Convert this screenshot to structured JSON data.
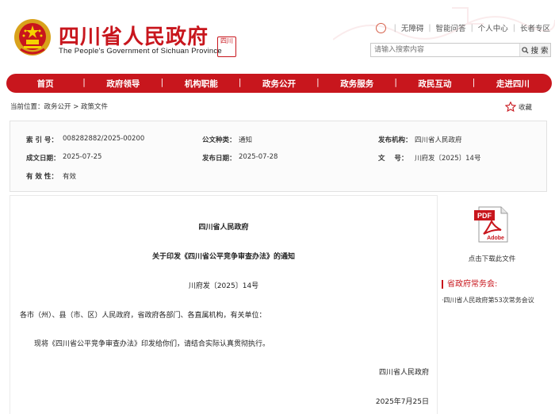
{
  "header": {
    "title_cn": "四川省人民政府",
    "title_en": "The People's Government of Sichuan Province",
    "seal_text": "四川",
    "links": [
      "无障碍",
      "智能问答",
      "个人中心",
      "长者专区"
    ],
    "search": {
      "placeholder": "请输入搜索内容",
      "button": "搜 索"
    }
  },
  "nav": [
    "首页",
    "政府领导",
    "机构职能",
    "政务公开",
    "政务服务",
    "政民互动",
    "走进四川"
  ],
  "breadcrumb": "当前位置：政务公开 > 政策文件",
  "collect_label": "收藏",
  "info": {
    "index_label": "索 引 号：",
    "index_value": "008282882/2025-00200",
    "type_label": "公文种类：",
    "type_value": "通知",
    "issuer_label": "发布机构：",
    "issuer_value": "四川省人民政府",
    "created_label": "成文日期：",
    "created_value": "2025-07-25",
    "published_label": "发布日期：",
    "published_value": "2025-07-28",
    "docno_label": "文    号：",
    "docno_value": "川府发〔2025〕14号",
    "validity_label": "有 效 性：",
    "validity_value": "有效"
  },
  "article": {
    "org": "四川省人民政府",
    "title": "关于印发《四川省公平竞争审查办法》的通知",
    "docno": "川府发〔2025〕14号",
    "recipients": "各市（州）、县（市、区）人民政府，省政府各部门、各直属机构，有关单位：",
    "body": "现将《四川省公平竞争审查办法》印发给你们，请结合实际认真贯彻执行。",
    "sign": "四川省人民政府",
    "date": "2025年7月25日"
  },
  "sidebar": {
    "pdf_word": "PDF",
    "adobe_word": "Adobe",
    "download_label": "点击下载此文件",
    "section_title": "省政府常务会:",
    "item": "·四川省人民政府第53次常务会议"
  },
  "colors": {
    "brand_red": "#c8161d"
  }
}
